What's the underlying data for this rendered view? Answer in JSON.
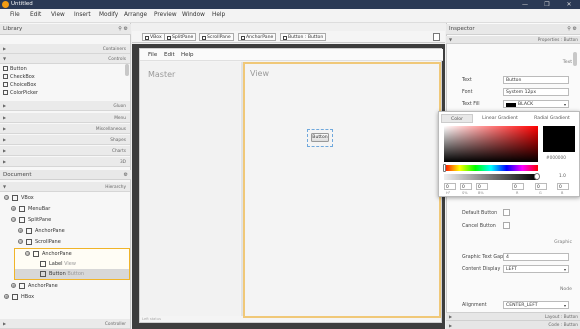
{
  "window": {
    "title": "Untitled",
    "controls": {
      "minimize": "—",
      "maximize": "❐",
      "close": "✕"
    }
  },
  "menubar": {
    "items": [
      "File",
      "Edit",
      "View",
      "Insert",
      "Modify",
      "Arrange",
      "Preview",
      "Window",
      "Help"
    ]
  },
  "library": {
    "title": "Library",
    "sections_top": [
      "Containers",
      "Controls"
    ],
    "items": [
      "Button",
      "CheckBox",
      "ChoiceBox",
      "ColorPicker"
    ],
    "sections_bottom": [
      "Gluon",
      "Menu",
      "Miscellaneous",
      "Shapes",
      "Charts",
      "3D"
    ]
  },
  "document": {
    "title": "Document",
    "section": "Hierarchy",
    "nodes": [
      {
        "label": "VBox",
        "sub": "",
        "depth": 0,
        "exp": "⊖"
      },
      {
        "label": "MenuBar",
        "sub": "",
        "depth": 1,
        "exp": "⊕"
      },
      {
        "label": "SplitPane",
        "sub": "",
        "depth": 1,
        "exp": "⊖"
      },
      {
        "label": "AnchorPane",
        "sub": "",
        "depth": 2,
        "exp": "⊕"
      },
      {
        "label": "ScrollPane",
        "sub": "",
        "depth": 2,
        "exp": "⊖"
      },
      {
        "label": "AnchorPane",
        "sub": "",
        "depth": 3,
        "exp": "⊖"
      },
      {
        "label": "Label",
        "sub": "View",
        "depth": 4,
        "exp": ""
      },
      {
        "label": "Button",
        "sub": "Button",
        "depth": 4,
        "exp": ""
      },
      {
        "label": "AnchorPane",
        "sub": "",
        "depth": 2,
        "exp": "⊕"
      },
      {
        "label": "HBox",
        "sub": "",
        "depth": 1,
        "exp": "⊕"
      }
    ],
    "controller": "Controller"
  },
  "breadcrumb": [
    "VBox",
    "SplitPane",
    "ScrollPane",
    "AnchorPane",
    "Button : Button"
  ],
  "preview": {
    "menu": [
      "File",
      "Edit",
      "Help"
    ],
    "master_label": "Master",
    "view_label": "View",
    "button_label": "Button",
    "status": "Left status"
  },
  "inspector": {
    "title": "Inspector",
    "properties_header": "Properties : Button",
    "text_section": "Text",
    "text_label": "Text",
    "text_value": "Button",
    "font_label": "Font",
    "font_value": "System 12px",
    "textfill_label": "Text Fill",
    "textfill_value": "BLACK",
    "default_button": "Default Button",
    "cancel_button": "Cancel Button",
    "graphic_section": "Graphic",
    "graphic_gap_label": "Graphic Text Gap",
    "graphic_gap_value": "4",
    "content_display_label": "Content Display",
    "content_display_value": "LEFT",
    "node_section": "Node",
    "alignment_label": "Alignment",
    "alignment_value": "CENTER_LEFT",
    "layout_header": "Layout : Button",
    "code_header": "Code : Button"
  },
  "color_picker": {
    "tabs": [
      "Color",
      "Linear Gradient",
      "Radial Gradient"
    ],
    "hex": "#000000",
    "alpha_value": "1.0",
    "fields": [
      "0",
      "0",
      "0",
      "0",
      "0",
      "0"
    ],
    "field_labels": [
      "H°",
      "S%",
      "B%",
      "R",
      "G",
      "B"
    ]
  },
  "colors": {
    "titlebar": "#2b3a55",
    "selection": "#f0b429",
    "canvas": "#3d3d3d"
  }
}
